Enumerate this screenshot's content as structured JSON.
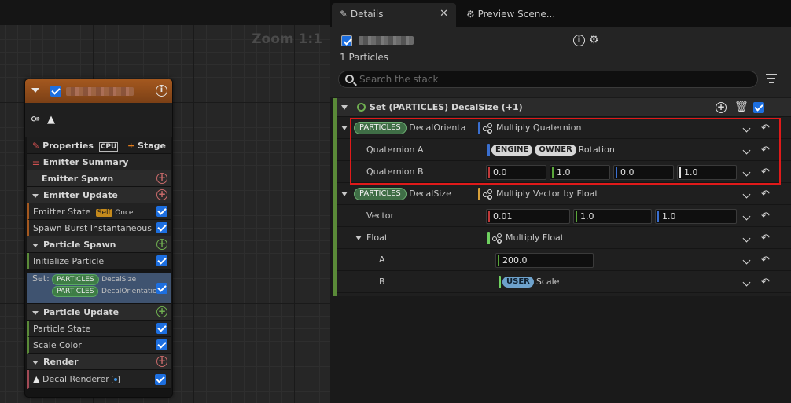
{
  "graph": {
    "zoom_label": "Zoom 1:1",
    "node": {
      "properties_label": "Properties",
      "cpu_label": "CPU",
      "stage_label": "Stage",
      "rows": [
        {
          "label": "Emitter Summary"
        },
        {
          "label": "Emitter Spawn"
        },
        {
          "label": "Emitter Update"
        },
        {
          "label": "Emitter State",
          "tag": "Self",
          "extra": "Once"
        },
        {
          "label": "Spawn Burst Instantaneous"
        },
        {
          "label": "Particle Spawn"
        },
        {
          "label": "Initialize Particle"
        },
        {
          "label": "Particle Update"
        },
        {
          "label": "Particle State"
        },
        {
          "label": "Scale Color"
        },
        {
          "label": "Render"
        },
        {
          "label": "Decal Renderer"
        }
      ],
      "set_row": {
        "prefix": "Set:",
        "line1_pill": "PARTICLES",
        "line1_text": "DecalSize",
        "line2_pill": "PARTICLES",
        "line2_text": "DecalOrientation"
      }
    }
  },
  "details": {
    "tabs": [
      {
        "label": "Details"
      },
      {
        "label": "Preview Scene..."
      }
    ],
    "particles_count": "1 Particles",
    "search_placeholder": "Search the stack",
    "module_title": "Set (PARTICLES) DecalSize (+1)",
    "rows": {
      "decal_orient": {
        "pill": "PARTICLES",
        "name": "DecalOrienta",
        "value": "Multiply Quaternion"
      },
      "quat_a": {
        "name": "Quaternion A",
        "pill1": "ENGINE",
        "pill2": "OWNER",
        "value": "Rotation"
      },
      "quat_b": {
        "name": "Quaternion B",
        "v": [
          "0.0",
          "1.0",
          "0.0",
          "1.0"
        ]
      },
      "decal_size": {
        "pill": "PARTICLES",
        "name": "DecalSize",
        "value": "Multiply Vector by Float"
      },
      "vector": {
        "name": "Vector",
        "v": [
          "0.01",
          "1.0",
          "1.0"
        ]
      },
      "float": {
        "name": "Float",
        "value": "Multiply Float"
      },
      "a": {
        "name": "A",
        "v": "200.0"
      },
      "b": {
        "name": "B",
        "pill": "USER",
        "value": "Scale"
      }
    }
  },
  "colors": {
    "accent_blue": "#1d6fe0",
    "highlight_red": "#e01a1a",
    "emitter_orange": "#a4581f",
    "particle_green": "#5a8a38"
  }
}
